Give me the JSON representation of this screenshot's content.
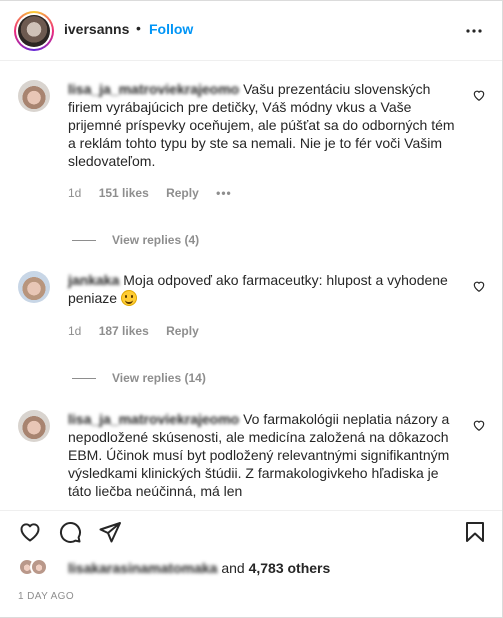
{
  "header": {
    "username": "iversanns",
    "separator": "•",
    "follow_label": "Follow"
  },
  "comments": [
    {
      "user": "lisa_ja_matroviekrajeomo",
      "text": " Vašu prezentáciu slovenských firiem vyrábajúcich pre detičky, Váš módny vkus a Vaše prijemné príspevky oceňujem, ale púšťat sa do odborných tém a reklám tohto typu by ste sa nemali. Nie je to fér voči Vašim sledovateľom.",
      "time": "1d",
      "likes": "151 likes",
      "reply_label": "Reply",
      "more": "•••",
      "view_replies": "View replies (4)"
    },
    {
      "user": "jankaka",
      "text": " Moja odpoveď ako farmaceutky: hlupost a vyhodene peniaze ",
      "time": "1d",
      "likes": "187 likes",
      "reply_label": "Reply",
      "view_replies": "View replies (14)"
    },
    {
      "user": "lisa_ja_matroviekrajeomo",
      "text": " Vo farmakológii neplatia názory a nepodložené skúsenosti, ale medicína založená na dôkazoch EBM. Účinok musí byt podložený relevantnými signifikantným výsledkami klinických štúdii. Z farmakologivkeho hľadiska je táto liečba neúčinná, má len"
    }
  ],
  "likes_summary": {
    "blurred_user": "lisakarasinamatomaka",
    "and_text": " and ",
    "others": "4,783 others"
  },
  "timestamp": "1 DAY AGO"
}
